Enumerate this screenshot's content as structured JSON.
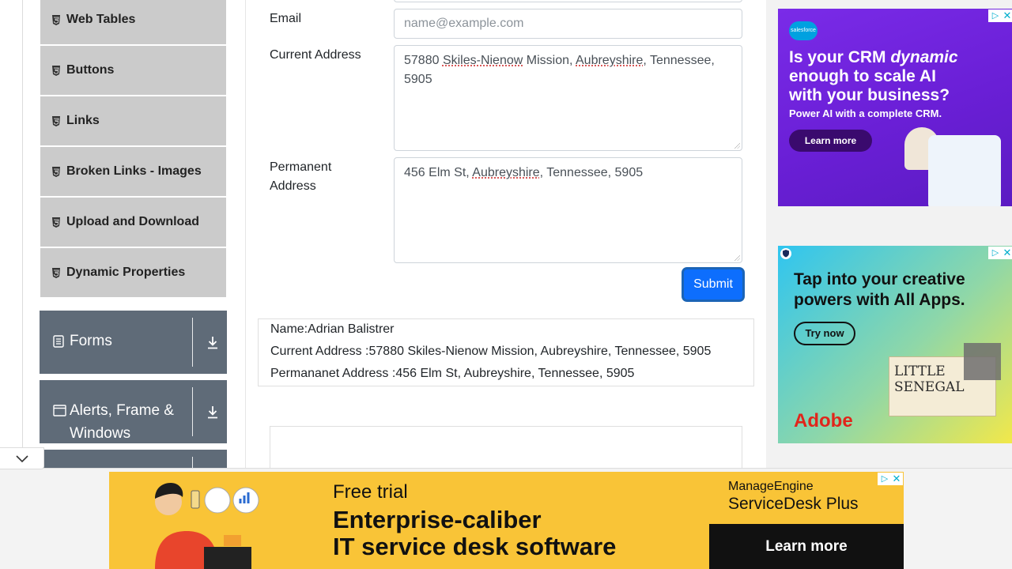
{
  "sidebar": {
    "items": [
      {
        "label": "Web Tables"
      },
      {
        "label": "Buttons"
      },
      {
        "label": "Links"
      },
      {
        "label": "Broken Links - Images"
      },
      {
        "label": "Upload and Download"
      },
      {
        "label": "Dynamic Properties"
      }
    ],
    "groups": [
      {
        "label": "Forms",
        "icon": "form-icon"
      },
      {
        "label_line1": "Alerts, Frame &",
        "label_line2": "Windows",
        "icon": "window-icon"
      }
    ]
  },
  "form": {
    "email_label": "Email",
    "email_placeholder": "name@example.com",
    "current_address_label": "Current Address",
    "current_address_value": {
      "p1": "57880 ",
      "s1": "Skiles-Nienow",
      "p2": " Mission, ",
      "s2": "Aubreyshire",
      "p3": ", Tennessee, 5905"
    },
    "permanent_address_label_line1": "Permanent",
    "permanent_address_label_line2": "Address",
    "permanent_address_value": {
      "p1": "456 Elm St, ",
      "s1": "Aubreyshire",
      "p2": ", Tennessee, 5905"
    },
    "submit_label": "Submit"
  },
  "output": {
    "name": "Name:Adrian Balistrer",
    "current_address": "Current Address :57880 Skiles-Nienow Mission, Aubreyshire, Tennessee, 5905",
    "permanent_address": "Permananet Address :456 Elm St, Aubreyshire, Tennessee, 5905"
  },
  "ads": {
    "crm": {
      "brand": "salesforce",
      "headline_line1_a": "Is your CRM ",
      "headline_line1_b": "dynamic",
      "headline_line2": "enough to scale AI",
      "headline_line3": "with your business?",
      "subline": "Power AI with a complete CRM.",
      "cta": "Learn more",
      "bg_color": "#7526e3"
    },
    "adobe": {
      "headline_line1": "Tap into your creative",
      "headline_line2": "powers with All Apps.",
      "cta": "Try now",
      "poster_line1": "LITTLE",
      "poster_line2": "SENEGAL",
      "brand": "Adobe",
      "bg_color": "#4fc7e8"
    },
    "servicedesk": {
      "kicker": "Free trial",
      "headline_line1": "Enterprise-caliber",
      "headline_line2": "IT service desk software",
      "brand_line1": "ManageEngine",
      "brand_line2": "ServiceDesk Plus",
      "cta": "Learn more",
      "bg_color": "#f9c437"
    }
  }
}
